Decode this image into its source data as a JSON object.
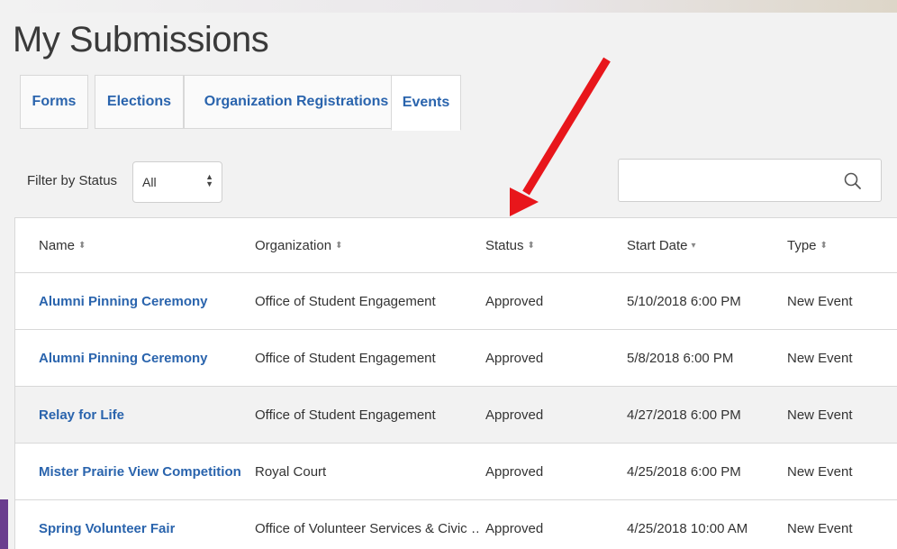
{
  "page_title": "My Submissions",
  "tabs": [
    {
      "label": "Forms",
      "active": false
    },
    {
      "label": "Elections",
      "active": false
    },
    {
      "label": "Organization Registrations",
      "active": false
    },
    {
      "label": "Events",
      "active": true
    }
  ],
  "filter": {
    "label": "Filter by Status",
    "selected": "All"
  },
  "search": {
    "placeholder": "",
    "value": "",
    "icon": "search-icon"
  },
  "table": {
    "columns": [
      {
        "label": "Name",
        "sort_icon": "⬍"
      },
      {
        "label": "Organization",
        "sort_icon": "⬍"
      },
      {
        "label": "Status",
        "sort_icon": "⬍"
      },
      {
        "label": "Start Date",
        "sort_icon": "▾"
      },
      {
        "label": "Type",
        "sort_icon": "⬍"
      }
    ],
    "rows": [
      {
        "name": "Alumni Pinning Ceremony",
        "organization": "Office of Student Engagement",
        "status": "Approved",
        "start_date": "5/10/2018 6:00 PM",
        "type": "New Event"
      },
      {
        "name": "Alumni Pinning Ceremony",
        "organization": "Office of Student Engagement",
        "status": "Approved",
        "start_date": "5/8/2018 6:00 PM",
        "type": "New Event"
      },
      {
        "name": "Relay for Life",
        "organization": "Office of Student Engagement",
        "status": "Approved",
        "start_date": "4/27/2018 6:00 PM",
        "type": "New Event"
      },
      {
        "name": "Mister Prairie View Competition",
        "organization": "Royal Court",
        "status": "Approved",
        "start_date": "4/25/2018 6:00 PM",
        "type": "New Event"
      },
      {
        "name": "Spring Volunteer Fair",
        "organization": "Office of Volunteer Services & Civic …",
        "status": "Approved",
        "start_date": "4/25/2018 10:00 AM",
        "type": "New Event"
      }
    ]
  },
  "colors": {
    "link": "#2a64ad",
    "annotation_arrow": "#e8161b",
    "highlight_row": "#f2f2f2"
  }
}
